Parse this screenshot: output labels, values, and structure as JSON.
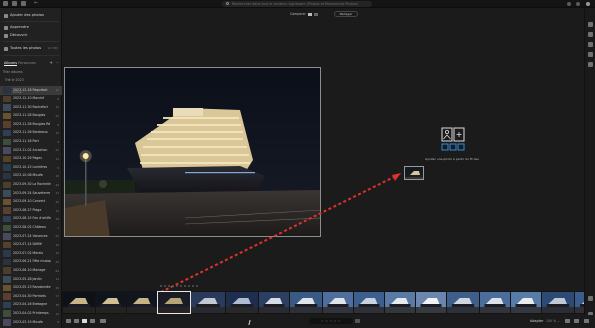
{
  "search": {
    "placeholder": "Rechercher dans tout le contenu Lightroom (Photos et Ressources Photos)"
  },
  "left_panel": {
    "add_photos": "Ajouter des photos",
    "nav": [
      {
        "label": "Apprendre",
        "icon": "learn-icon"
      },
      {
        "label": "Découvrir",
        "icon": "discover-icon"
      }
    ],
    "all_photos": {
      "label": "Toutes les photos",
      "count": "12 580"
    },
    "tabs": {
      "albums": "Albums",
      "people": "Personnes"
    },
    "add_symbol": "+",
    "more_symbol": "⋯",
    "filter_label": "Trier albums",
    "date_group": "Trié le 2023",
    "albums": [
      {
        "name": "2023-12-16 Paquebot",
        "count": "12",
        "sub": "Partagé",
        "selected": true
      },
      {
        "name": "2023-12-10 Marché",
        "count": "8"
      },
      {
        "name": "2023-11-30 Rochefort",
        "count": "15"
      },
      {
        "name": "2023-11-28 Bougies",
        "count": "21"
      },
      {
        "name": "2023-11-28 Bougies Ré",
        "count": "6"
      },
      {
        "name": "2023-11-26 Bordeaux",
        "count": "34"
      },
      {
        "name": "2023-11-18 Port",
        "count": "9"
      },
      {
        "name": "2023-11-02 Arcachon",
        "count": "27"
      },
      {
        "name": "2023-10-29 Pages",
        "count": "11"
      },
      {
        "name": "2023-10-15 Lumières",
        "count": "5"
      },
      {
        "name": "2023-10-08 Musée",
        "count": "19"
      },
      {
        "name": "2023-09-30 La Rochelle",
        "count": "44"
      },
      {
        "name": "2023-09-24 Sauveterre",
        "count": "13"
      },
      {
        "name": "2023-09-10 Concert",
        "count": "22"
      },
      {
        "name": "2023-08-27 Plage",
        "count": "31"
      },
      {
        "name": "2023-08-15 Feu d'artifice",
        "count": "18"
      },
      {
        "name": "2023-08-02 Château",
        "count": "7"
      },
      {
        "name": "2023-07-24 Vacances",
        "count": "52"
      },
      {
        "name": "2023-07-14 Défilé",
        "count": "16"
      },
      {
        "name": "2023-07-02 Marais",
        "count": "10"
      },
      {
        "name": "2023-06-21 Fête musique",
        "count": "23"
      },
      {
        "name": "2023-06-10 Mariage",
        "count": "64"
      },
      {
        "name": "2023-05-28 Jardin",
        "count": "14"
      },
      {
        "name": "2023-05-13 Randonnée",
        "count": "29"
      },
      {
        "name": "2023-04-30 Portraits",
        "count": "17"
      },
      {
        "name": "2023-04-16 Bretagne",
        "count": "38"
      },
      {
        "name": "2023-04-02 Printemps",
        "count": "12"
      },
      {
        "name": "2023-03-19 Musée",
        "count": "8"
      },
      {
        "name": "2023-03-05 Ville",
        "count": "20"
      }
    ]
  },
  "header": {
    "compare_label": "Comparer",
    "share_label": "Partager"
  },
  "drop_hint": {
    "text": "Ajouter une photo à partir du fil des"
  },
  "bottom": {
    "stars": "☆ ☆ ☆ ☆ ☆",
    "fit": "Adapter",
    "zoom": "100 % ⌄"
  },
  "colors": {
    "accent_arrow": "#e0322c",
    "background": "#1b1b1b",
    "panel": "#212121"
  }
}
